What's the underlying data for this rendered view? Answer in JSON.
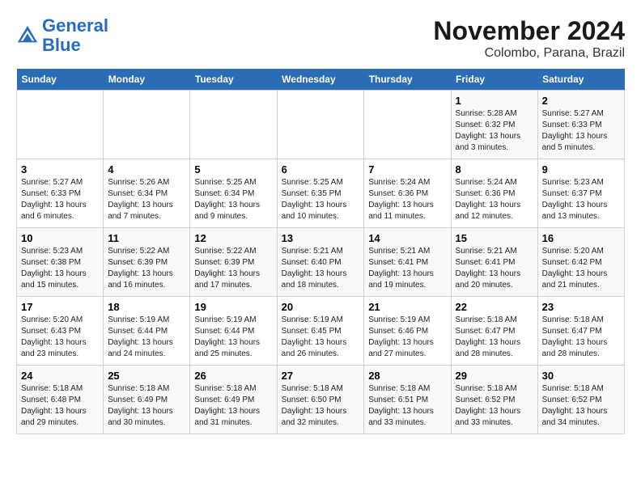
{
  "header": {
    "logo_line1": "General",
    "logo_line2": "Blue",
    "month": "November 2024",
    "location": "Colombo, Parana, Brazil"
  },
  "weekdays": [
    "Sunday",
    "Monday",
    "Tuesday",
    "Wednesday",
    "Thursday",
    "Friday",
    "Saturday"
  ],
  "weeks": [
    [
      {
        "day": "",
        "info": ""
      },
      {
        "day": "",
        "info": ""
      },
      {
        "day": "",
        "info": ""
      },
      {
        "day": "",
        "info": ""
      },
      {
        "day": "",
        "info": ""
      },
      {
        "day": "1",
        "info": "Sunrise: 5:28 AM\nSunset: 6:32 PM\nDaylight: 13 hours and 3 minutes."
      },
      {
        "day": "2",
        "info": "Sunrise: 5:27 AM\nSunset: 6:33 PM\nDaylight: 13 hours and 5 minutes."
      }
    ],
    [
      {
        "day": "3",
        "info": "Sunrise: 5:27 AM\nSunset: 6:33 PM\nDaylight: 13 hours and 6 minutes."
      },
      {
        "day": "4",
        "info": "Sunrise: 5:26 AM\nSunset: 6:34 PM\nDaylight: 13 hours and 7 minutes."
      },
      {
        "day": "5",
        "info": "Sunrise: 5:25 AM\nSunset: 6:34 PM\nDaylight: 13 hours and 9 minutes."
      },
      {
        "day": "6",
        "info": "Sunrise: 5:25 AM\nSunset: 6:35 PM\nDaylight: 13 hours and 10 minutes."
      },
      {
        "day": "7",
        "info": "Sunrise: 5:24 AM\nSunset: 6:36 PM\nDaylight: 13 hours and 11 minutes."
      },
      {
        "day": "8",
        "info": "Sunrise: 5:24 AM\nSunset: 6:36 PM\nDaylight: 13 hours and 12 minutes."
      },
      {
        "day": "9",
        "info": "Sunrise: 5:23 AM\nSunset: 6:37 PM\nDaylight: 13 hours and 13 minutes."
      }
    ],
    [
      {
        "day": "10",
        "info": "Sunrise: 5:23 AM\nSunset: 6:38 PM\nDaylight: 13 hours and 15 minutes."
      },
      {
        "day": "11",
        "info": "Sunrise: 5:22 AM\nSunset: 6:39 PM\nDaylight: 13 hours and 16 minutes."
      },
      {
        "day": "12",
        "info": "Sunrise: 5:22 AM\nSunset: 6:39 PM\nDaylight: 13 hours and 17 minutes."
      },
      {
        "day": "13",
        "info": "Sunrise: 5:21 AM\nSunset: 6:40 PM\nDaylight: 13 hours and 18 minutes."
      },
      {
        "day": "14",
        "info": "Sunrise: 5:21 AM\nSunset: 6:41 PM\nDaylight: 13 hours and 19 minutes."
      },
      {
        "day": "15",
        "info": "Sunrise: 5:21 AM\nSunset: 6:41 PM\nDaylight: 13 hours and 20 minutes."
      },
      {
        "day": "16",
        "info": "Sunrise: 5:20 AM\nSunset: 6:42 PM\nDaylight: 13 hours and 21 minutes."
      }
    ],
    [
      {
        "day": "17",
        "info": "Sunrise: 5:20 AM\nSunset: 6:43 PM\nDaylight: 13 hours and 23 minutes."
      },
      {
        "day": "18",
        "info": "Sunrise: 5:19 AM\nSunset: 6:44 PM\nDaylight: 13 hours and 24 minutes."
      },
      {
        "day": "19",
        "info": "Sunrise: 5:19 AM\nSunset: 6:44 PM\nDaylight: 13 hours and 25 minutes."
      },
      {
        "day": "20",
        "info": "Sunrise: 5:19 AM\nSunset: 6:45 PM\nDaylight: 13 hours and 26 minutes."
      },
      {
        "day": "21",
        "info": "Sunrise: 5:19 AM\nSunset: 6:46 PM\nDaylight: 13 hours and 27 minutes."
      },
      {
        "day": "22",
        "info": "Sunrise: 5:18 AM\nSunset: 6:47 PM\nDaylight: 13 hours and 28 minutes."
      },
      {
        "day": "23",
        "info": "Sunrise: 5:18 AM\nSunset: 6:47 PM\nDaylight: 13 hours and 28 minutes."
      }
    ],
    [
      {
        "day": "24",
        "info": "Sunrise: 5:18 AM\nSunset: 6:48 PM\nDaylight: 13 hours and 29 minutes."
      },
      {
        "day": "25",
        "info": "Sunrise: 5:18 AM\nSunset: 6:49 PM\nDaylight: 13 hours and 30 minutes."
      },
      {
        "day": "26",
        "info": "Sunrise: 5:18 AM\nSunset: 6:49 PM\nDaylight: 13 hours and 31 minutes."
      },
      {
        "day": "27",
        "info": "Sunrise: 5:18 AM\nSunset: 6:50 PM\nDaylight: 13 hours and 32 minutes."
      },
      {
        "day": "28",
        "info": "Sunrise: 5:18 AM\nSunset: 6:51 PM\nDaylight: 13 hours and 33 minutes."
      },
      {
        "day": "29",
        "info": "Sunrise: 5:18 AM\nSunset: 6:52 PM\nDaylight: 13 hours and 33 minutes."
      },
      {
        "day": "30",
        "info": "Sunrise: 5:18 AM\nSunset: 6:52 PM\nDaylight: 13 hours and 34 minutes."
      }
    ]
  ]
}
